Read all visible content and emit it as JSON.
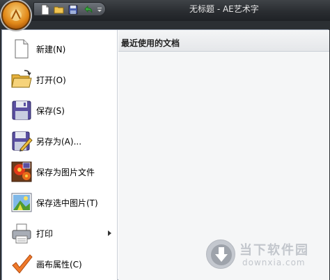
{
  "window": {
    "title": "无标题 - AE艺术字"
  },
  "quick_access": {
    "buttons": [
      "new-doc-icon",
      "open-folder-icon",
      "save-disk-icon",
      "undo-arrow-icon",
      "customize-dropdown-icon"
    ]
  },
  "menu": {
    "items": [
      {
        "label": "新建(N)",
        "icon": "new-document-icon"
      },
      {
        "label": "打开(O)",
        "icon": "open-folder-icon"
      },
      {
        "label": "保存(S)",
        "icon": "save-disk-icon"
      },
      {
        "label": "另存为(A)...",
        "icon": "save-as-icon"
      },
      {
        "label": "保存为图片文件",
        "icon": "save-image-icon"
      },
      {
        "label": "保存选中图片(T)",
        "icon": "save-selection-icon"
      },
      {
        "label": "打印",
        "icon": "printer-icon",
        "has_submenu": true
      },
      {
        "label": "画布属性(C)",
        "icon": "checkmark-icon"
      }
    ]
  },
  "recent": {
    "header": "最近使用的文档"
  },
  "watermark": {
    "title": "当下软件园",
    "url": "downxia.com"
  }
}
